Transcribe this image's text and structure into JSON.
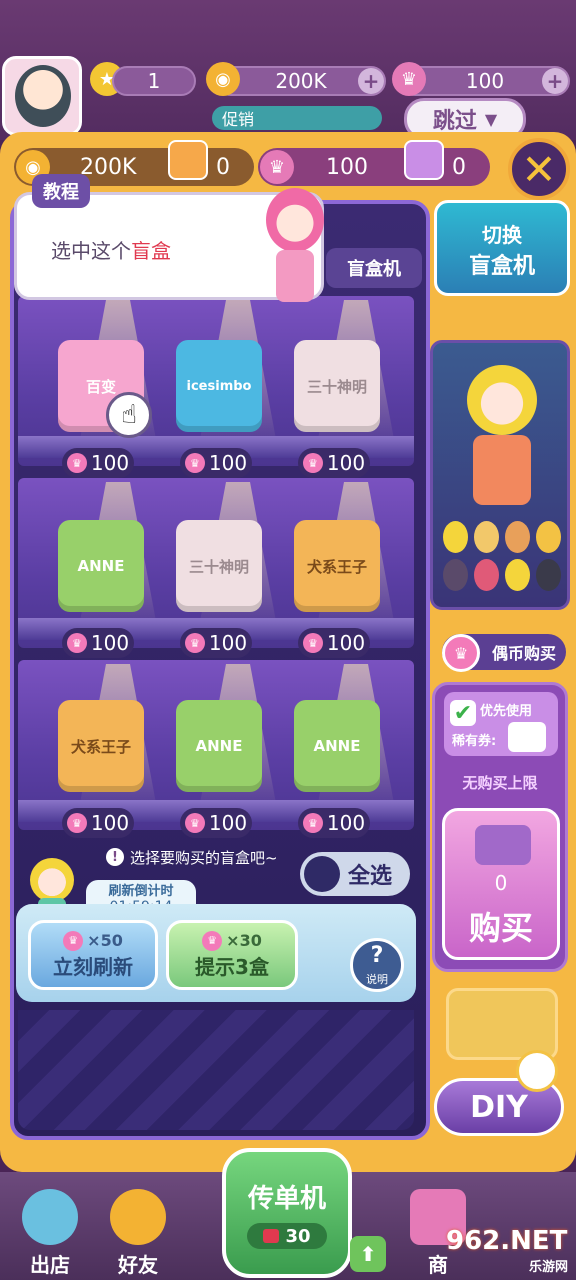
{
  "top": {
    "stars": "1",
    "coins": "200K",
    "gems": "100",
    "promo": "促销",
    "skip": "跳过"
  },
  "frame": {
    "coins": "200K",
    "coin_tickets": "0",
    "gems": "100",
    "gem_tickets": "0"
  },
  "tutorial": {
    "tag": "教程",
    "text_prefix": "选中这个",
    "text_highlight": "盲盒"
  },
  "machine_label": "盲盒机",
  "shelves": [
    [
      {
        "label": "百变",
        "price": "100",
        "color": "#f6a6cf"
      },
      {
        "label": "icesimbo",
        "price": "100",
        "color": "#4cb8e2"
      },
      {
        "label": "三十神明",
        "price": "100",
        "color": "#f0dfe2"
      }
    ],
    [
      {
        "label": "ANNE",
        "price": "100",
        "color": "#98d06a"
      },
      {
        "label": "三十神明",
        "price": "100",
        "color": "#f0dfe2"
      },
      {
        "label": "犬系王子",
        "price": "100",
        "color": "#f3b557"
      }
    ],
    [
      {
        "label": "犬系王子",
        "price": "100",
        "color": "#f3b557"
      },
      {
        "label": "ANNE",
        "price": "100",
        "color": "#98d06a"
      },
      {
        "label": "ANNE",
        "price": "100",
        "color": "#98d06a"
      }
    ]
  ],
  "select_hint": "选择要购买的盲盒吧~",
  "select_all": "全选",
  "refresh": {
    "label": "刷新倒计时",
    "time": "01:59:14"
  },
  "controls": {
    "refresh_cost": "×50",
    "refresh_label": "立刻刷新",
    "hint_cost": "×30",
    "hint_label": "提示3盒",
    "help_label": "说明"
  },
  "right": {
    "switch_line1": "切换",
    "switch_line2": "盲盒机",
    "coin_buy": "偶币购买",
    "priority_line1": "优先使用",
    "priority_line2": "稀有券:",
    "no_limit": "无购买上限",
    "buy_count": "0",
    "buy_label": "购买",
    "diy": "DIY"
  },
  "bottom": {
    "shop_out": "出店",
    "friends": "好友",
    "flyer": "传单机",
    "flyer_count": "30",
    "store": "商",
    "watermark_main": "962.NET",
    "watermark_sub": "乐游网"
  },
  "colors": {
    "gold": "#f5b843",
    "purple_dark": "#2a1f5a",
    "pink": "#f37ab9",
    "highlight_red": "#e0394f"
  }
}
